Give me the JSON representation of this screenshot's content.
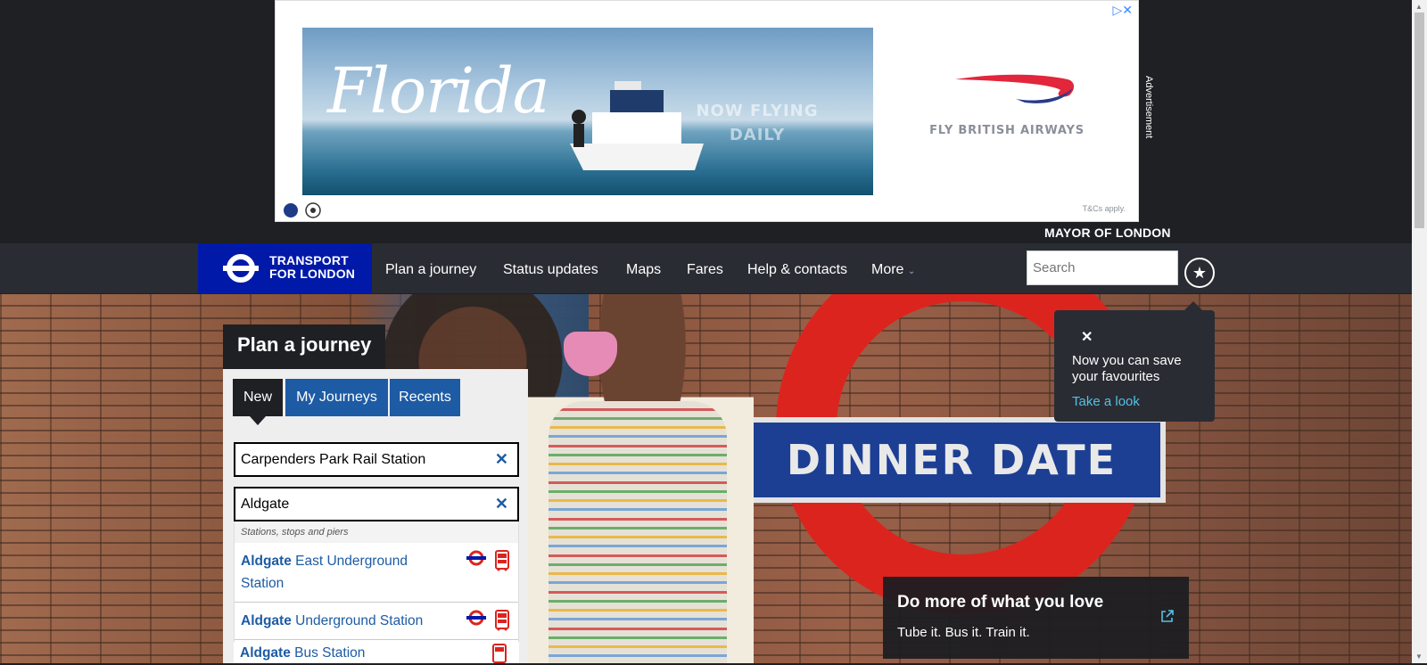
{
  "ad": {
    "headline": "Florida",
    "tagline_line1": "NOW FLYING",
    "tagline_line2": "DAILY",
    "brand_cta": "FLY BRITISH AIRWAYS",
    "terms": "T&Cs apply.",
    "side_label": "Advertisement",
    "close_icon": "close-icon",
    "adchoices_icon": "adchoices-icon"
  },
  "header": {
    "mayor": "MAYOR OF LONDON",
    "logo_line1": "TRANSPORT",
    "logo_line2": "FOR LONDON",
    "nav": [
      "Plan a journey",
      "Status updates",
      "Maps",
      "Fares",
      "Help & contacts",
      "More"
    ],
    "search_placeholder": "Search",
    "favourites_icon": "star-icon"
  },
  "hero": {
    "sign_text": "DINNER DATE",
    "promo_title": "Do more of what you love",
    "promo_subtitle": "Tube it. Bus it. Train it."
  },
  "favourites_popup": {
    "close": "✕",
    "message": "Now you can save your favourites",
    "link": "Take a look"
  },
  "journey_planner": {
    "title": "Plan a journey",
    "tabs": [
      "New",
      "My Journeys",
      "Recents"
    ],
    "from_value": "Carpenders Park Rail Station",
    "to_value": "Aldgate",
    "clear_icon": "✕",
    "dropdown": {
      "category": "Stations, stops and piers",
      "results": [
        {
          "match": "Aldgate",
          "rest": " East Underground Station",
          "modes": [
            "tube",
            "bus"
          ]
        },
        {
          "match": "Aldgate",
          "rest": " Underground Station",
          "modes": [
            "tube",
            "bus"
          ]
        },
        {
          "match": "Aldgate",
          "rest": " Bus Station",
          "modes": [
            "bus"
          ]
        }
      ]
    }
  },
  "colors": {
    "tfl_blue": "#0019a8",
    "link_blue": "#1d5ba4",
    "roundel_red": "#dc241f",
    "dark": "#1f2024"
  }
}
